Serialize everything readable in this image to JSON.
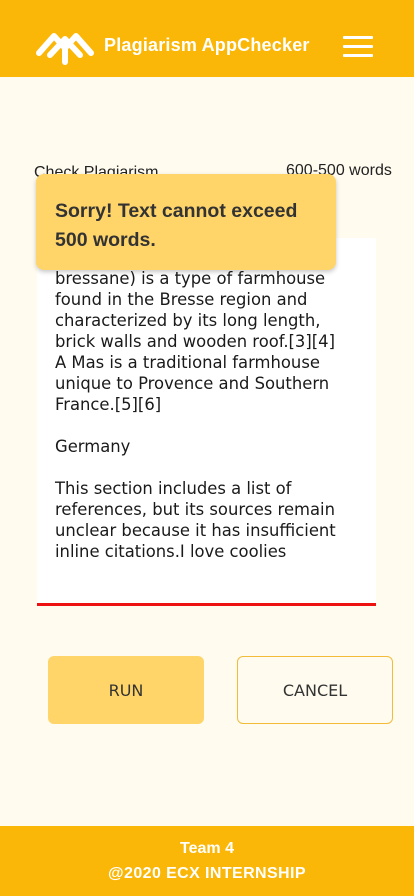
{
  "header": {
    "title": "Plagiarism AppChecker",
    "logo": "mountain-logo-icon",
    "menu_icon": "hamburger-icon",
    "background": "#fbb708"
  },
  "labels": {
    "check": "Check Plagiarism",
    "word_range": "600-500 words"
  },
  "textarea": {
    "content": "bressane) is a type of farmhouse found in the Bresse region and characterized by its long length, brick walls and wooden roof.[3][4] A Mas is a traditional farmhouse unique to Provence and Southern France.[5][6]\n\nGermany\n\nThis section includes a list of references, but its sources remain unclear because it has insufficient inline citations.I love coolies",
    "underline_color": "#ee1111"
  },
  "toast": {
    "message": "Sorry! Text cannot exceed 500 words.",
    "background": "#ffd56a"
  },
  "buttons": {
    "run": "RUN",
    "cancel": "CANCEL"
  },
  "footer": {
    "team": "Team 4",
    "copyright": "@2020 ECX INTERNSHIP"
  }
}
